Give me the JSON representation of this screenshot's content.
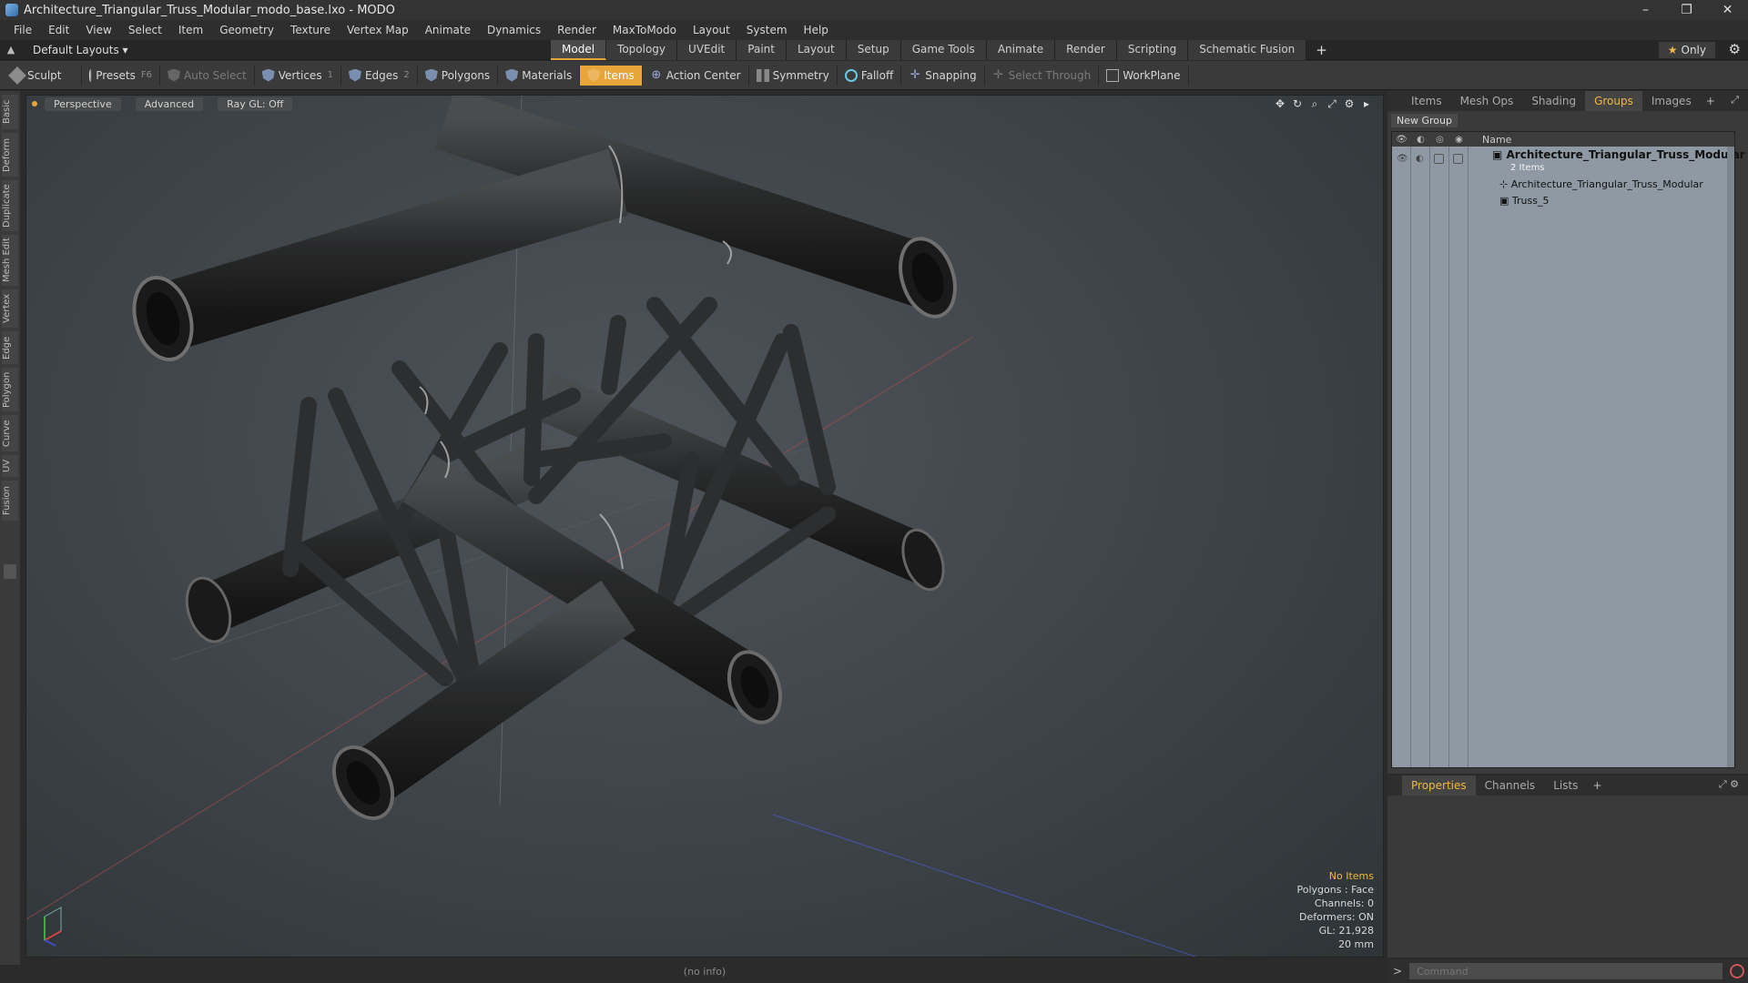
{
  "window": {
    "title": "Architecture_Triangular_Truss_Modular_modo_base.lxo - MODO"
  },
  "menu": [
    "File",
    "Edit",
    "View",
    "Select",
    "Item",
    "Geometry",
    "Texture",
    "Vertex Map",
    "Animate",
    "Dynamics",
    "Render",
    "MaxToModo",
    "Layout",
    "System",
    "Help"
  ],
  "layout": {
    "selector": "Default Layouts",
    "tabs": [
      "Model",
      "Topology",
      "UVEdit",
      "Paint",
      "Layout",
      "Setup",
      "Game Tools",
      "Animate",
      "Render",
      "Scripting",
      "Schematic Fusion"
    ],
    "active_tab": "Model",
    "only_label": "Only"
  },
  "toolbar": {
    "sculpt": "Sculpt",
    "presets": "Presets",
    "presets_key": "F6",
    "auto_select": "Auto Select",
    "vertices": "Vertices",
    "vertices_count": "1",
    "edges": "Edges",
    "edges_count": "2",
    "polygons": "Polygons",
    "materials": "Materials",
    "items": "Items",
    "action_center": "Action Center",
    "symmetry": "Symmetry",
    "falloff": "Falloff",
    "snapping": "Snapping",
    "select_through": "Select Through",
    "workplane": "WorkPlane"
  },
  "left_tabs": [
    "Basic",
    "Deform",
    "Duplicate",
    "Mesh Edit",
    "Vertex",
    "Edge",
    "Polygon",
    "Curve",
    "UV",
    "Fusion"
  ],
  "viewport": {
    "view": "Perspective",
    "shading": "Advanced",
    "raygl": "Ray GL: Off",
    "stats": {
      "selection": "No Items",
      "polygons": "Polygons : Face",
      "channels": "Channels: 0",
      "deformers": "Deformers: ON",
      "gl": "GL: 21,928",
      "scale": "20 mm"
    }
  },
  "status": "(no info)",
  "right_panel": {
    "tabs": [
      "Items",
      "Mesh Ops",
      "Shading",
      "Groups",
      "Images"
    ],
    "active_tab": "Groups",
    "new_group": "New Group",
    "column_name": "Name",
    "group_name": "Architecture_Triangular_Truss_Modular (...",
    "group_count": "2 Items",
    "items": [
      "Architecture_Triangular_Truss_Modular",
      "Truss_5"
    ]
  },
  "properties_panel": {
    "tabs": [
      "Properties",
      "Channels",
      "Lists"
    ],
    "active_tab": "Properties"
  },
  "command": {
    "placeholder": "Command"
  }
}
